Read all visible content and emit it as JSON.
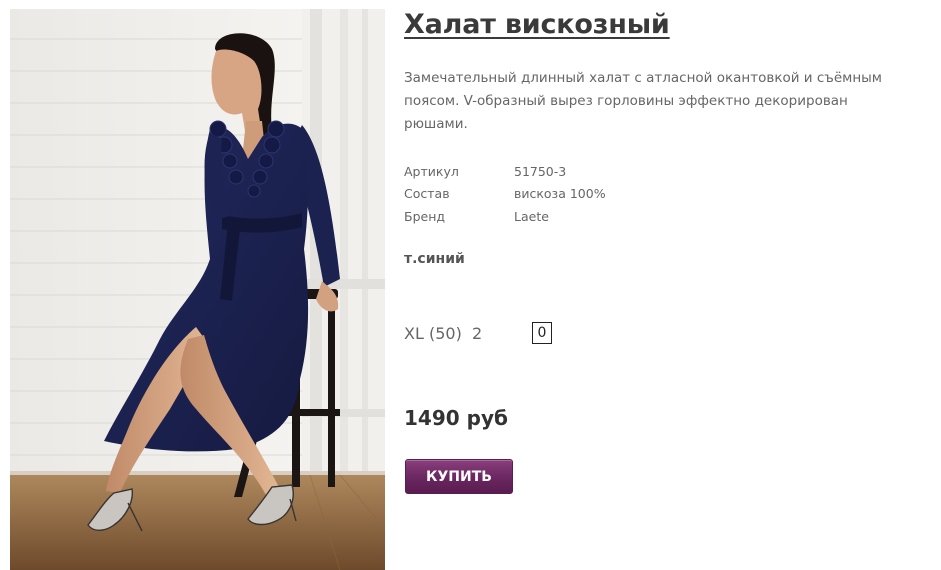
{
  "product": {
    "title": "Халат вискозный",
    "description": "Замечательный длинный халат с атласной окантовкой и съёмным поясом. V-образный вырез горловины эффектно декорирован рюшами.",
    "properties": [
      {
        "label": "Артикул",
        "value": "51750-3"
      },
      {
        "label": "Состав",
        "value": "вискоза 100%"
      },
      {
        "label": "Бренд",
        "value": "Laete"
      }
    ],
    "color": "т.синий",
    "sizes": [
      {
        "size": "XL (50)",
        "stock": "2",
        "quantity": "0"
      }
    ],
    "price": "1490 руб",
    "buy_label": "КУПИТЬ"
  },
  "colors": {
    "dress": "#1d2252",
    "buy_button": "#6a2660",
    "title": "#3a3a3a"
  }
}
